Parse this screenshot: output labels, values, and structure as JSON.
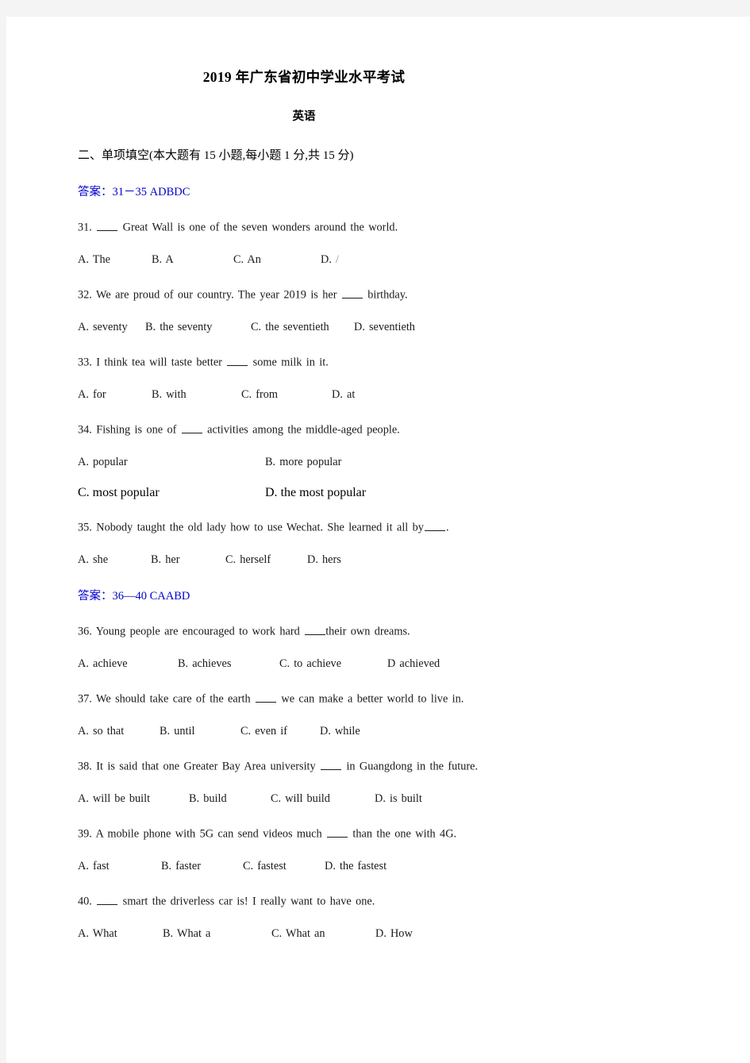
{
  "document": {
    "title": "2019 年广东省初中学业水平考试",
    "subtitle": "英语",
    "section_heading": "二、单项填空(本大题有 15 小题,每小题 1 分,共 15 分)"
  },
  "answer_keys": [
    {
      "label": "答案：",
      "range": "31－35",
      "letters": "ADBDC",
      "color": "#0000cc"
    },
    {
      "label": "答案：",
      "range": "36—40",
      "letters": "CAABD",
      "color": "#0000cc"
    }
  ],
  "questions": [
    {
      "number": "31.",
      "text_before_blank": "",
      "text_after_blank": "Great Wall is one of the seven wonders around the world.",
      "options": [
        {
          "key": "A.",
          "text": "The"
        },
        {
          "key": "B.",
          "text": "A"
        },
        {
          "key": "C.",
          "text": "An"
        },
        {
          "key": "D.",
          "text": "/"
        }
      ]
    },
    {
      "number": "32.",
      "text_before_blank": "We are proud of our country. The year 2019 is her",
      "text_after_blank": "birthday.",
      "options": [
        {
          "key": "A.",
          "text": "seventy"
        },
        {
          "key": "B.",
          "text": "the seventy"
        },
        {
          "key": "C.",
          "text": "the seventieth"
        },
        {
          "key": "D.",
          "text": "seventieth"
        }
      ]
    },
    {
      "number": "33.",
      "text_before_blank": "I think tea will taste better",
      "text_after_blank": "some milk in it.",
      "options": [
        {
          "key": "A.",
          "text": "for"
        },
        {
          "key": "B.",
          "text": "with"
        },
        {
          "key": "C.",
          "text": "from"
        },
        {
          "key": "D.",
          "text": "at"
        }
      ]
    },
    {
      "number": "34.",
      "text_before_blank": "Fishing is one of",
      "text_after_blank": "activities among the middle-aged people.",
      "options": [
        {
          "key": "A.",
          "text": "popular"
        },
        {
          "key": "B.",
          "text": "more popular"
        },
        {
          "key": "C.",
          "text": "most popular"
        },
        {
          "key": "D.",
          "text": "the most popular"
        }
      ]
    },
    {
      "number": "35.",
      "text_before_blank": "Nobody taught the old lady how to use Wechat. She learned it all by",
      "text_after_blank": ".",
      "options": [
        {
          "key": "A.",
          "text": "she"
        },
        {
          "key": "B.",
          "text": "her"
        },
        {
          "key": "C.",
          "text": "herself"
        },
        {
          "key": "D.",
          "text": "hers"
        }
      ]
    },
    {
      "number": "36.",
      "text_before_blank": "Young people are encouraged to work hard",
      "text_after_blank": "their own dreams.",
      "options": [
        {
          "key": "A.",
          "text": "achieve"
        },
        {
          "key": "B.",
          "text": "achieves"
        },
        {
          "key": "C.",
          "text": "to achieve"
        },
        {
          "key": "D",
          "text": "achieved"
        }
      ]
    },
    {
      "number": "37.",
      "text_before_blank": "We should take care of the earth",
      "text_after_blank": "we can make a better world to live in.",
      "options": [
        {
          "key": "A.",
          "text": "so that"
        },
        {
          "key": "B.",
          "text": "until"
        },
        {
          "key": "C.",
          "text": "even if"
        },
        {
          "key": "D.",
          "text": "while"
        }
      ]
    },
    {
      "number": "38.",
      "text_before_blank": "It is said that one Greater Bay Area university",
      "text_after_blank": "in Guangdong in the future.",
      "options": [
        {
          "key": "A.",
          "text": "will be built"
        },
        {
          "key": "B.",
          "text": "build"
        },
        {
          "key": "C.",
          "text": "will build"
        },
        {
          "key": "D.",
          "text": "is built"
        }
      ]
    },
    {
      "number": "39.",
      "text_before_blank": "A mobile phone with 5G can send videos much",
      "text_after_blank": "than the one with 4G.",
      "options": [
        {
          "key": "A.",
          "text": "fast"
        },
        {
          "key": "B.",
          "text": "faster"
        },
        {
          "key": "C.",
          "text": "fastest"
        },
        {
          "key": "D.",
          "text": "the fastest"
        }
      ]
    },
    {
      "number": "40.",
      "text_before_blank": "",
      "text_after_blank": "smart the driverless car is! I really want to have one.",
      "options": [
        {
          "key": "A.",
          "text": "What"
        },
        {
          "key": "B.",
          "text": "What a"
        },
        {
          "key": "C.",
          "text": "What an"
        },
        {
          "key": "D.",
          "text": "How"
        }
      ]
    }
  ]
}
